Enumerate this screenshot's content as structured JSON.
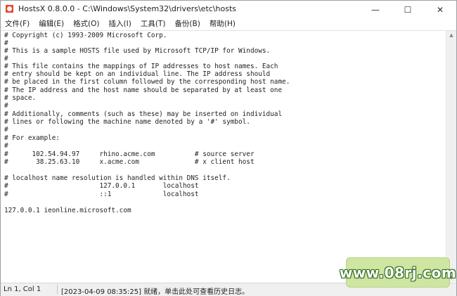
{
  "titlebar": {
    "title": "HostsX 0.8.0.0 - C:\\Windows\\System32\\drivers\\etc\\hosts",
    "minimize_glyph": "—",
    "maximize_glyph": "☐",
    "close_glyph": "✕"
  },
  "menu": [
    {
      "label": "文件(F)"
    },
    {
      "label": "编辑(E)"
    },
    {
      "label": "格式(O)"
    },
    {
      "label": "插入(I)"
    },
    {
      "label": "工具(T)"
    },
    {
      "label": "备份(B)"
    },
    {
      "label": "帮助(H)"
    }
  ],
  "editor": {
    "lines": [
      "# Copyright (c) 1993-2009 Microsoft Corp.",
      "#",
      "# This is a sample HOSTS file used by Microsoft TCP/IP for Windows.",
      "#",
      "# This file contains the mappings of IP addresses to host names. Each",
      "# entry should be kept on an individual line. The IP address should",
      "# be placed in the first column followed by the corresponding host name.",
      "# The IP address and the host name should be separated by at least one",
      "# space.",
      "#",
      "# Additionally, comments (such as these) may be inserted on individual",
      "# lines or following the machine name denoted by a '#' symbol.",
      "#",
      "# For example:",
      "#",
      "#      102.54.94.97     rhino.acme.com          # source server",
      "#       38.25.63.10     x.acme.com              # x client host",
      "",
      "# localhost name resolution is handled within DNS itself.",
      "#                       127.0.0.1       localhost",
      "#                       ::1             localhost",
      "",
      "127.0.0.1 ieonline.microsoft.com"
    ]
  },
  "statusbar": {
    "position": "Ln 1, Col 1",
    "message": "[2023-04-09 08:35:25] 就绪，单击此处可查看历史日志。"
  },
  "watermark": {
    "text": "www.08rj.com"
  }
}
